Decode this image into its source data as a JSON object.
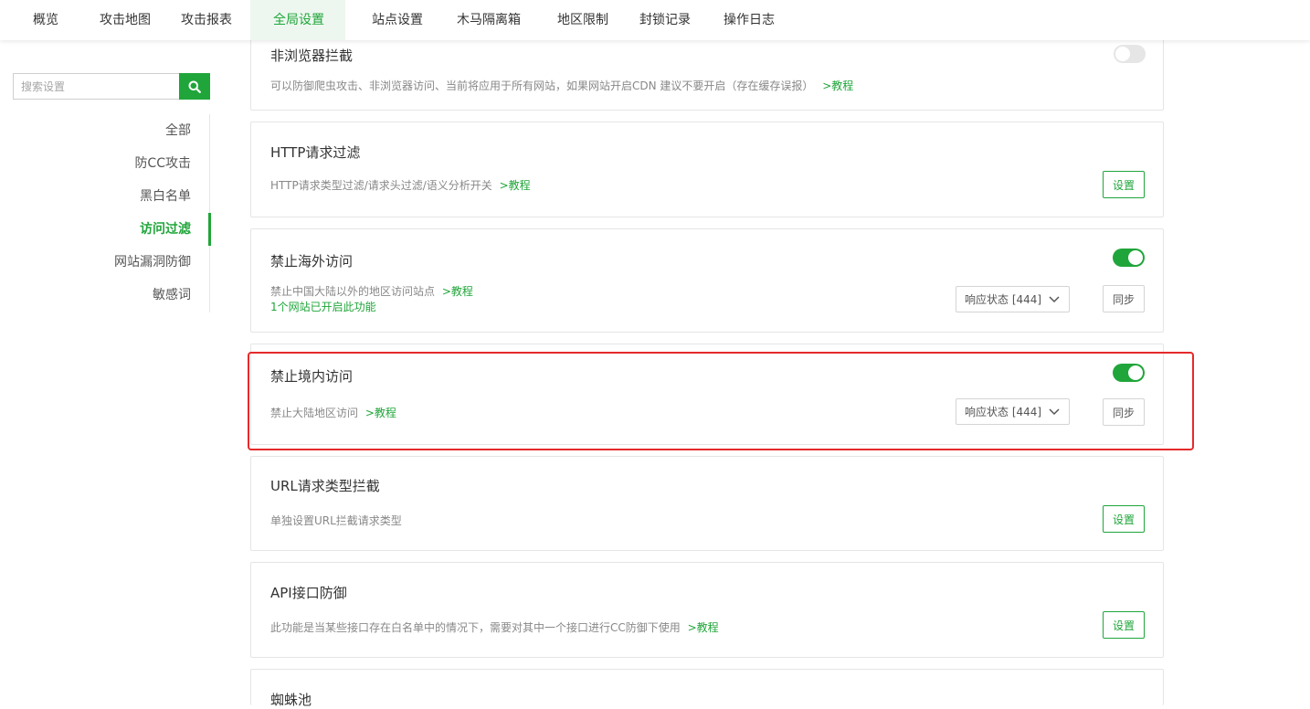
{
  "nav": {
    "tabs": [
      "概览",
      "攻击地图",
      "攻击报表",
      "全局设置",
      "站点设置",
      "木马隔离箱",
      "地区限制",
      "封锁记录",
      "操作日志"
    ],
    "active_index": 3
  },
  "sidebar": {
    "search_placeholder": "搜索设置",
    "items": [
      "全部",
      "防CC攻击",
      "黑白名单",
      "访问过滤",
      "网站漏洞防御",
      "敏感词"
    ],
    "active_index": 3
  },
  "cards": {
    "browser_intercept": {
      "title": "非浏览器拦截",
      "desc": "可以防御爬虫攻击、非浏览器访问、当前将应用于所有网站，如果网站开启CDN 建议不要开启（存在缓存误报）",
      "link": ">教程",
      "enabled": false
    },
    "http_filter": {
      "title": "HTTP请求过滤",
      "desc": "HTTP请求类型过滤/请求头过滤/语义分析开关",
      "link": ">教程",
      "button": "设置"
    },
    "ban_overseas": {
      "title": "禁止海外访问",
      "desc": "禁止中国大陆以外的地区访问站点",
      "link": ">教程",
      "sub": "1个网站已开启此功能",
      "select_value": "响应状态 [444]",
      "button": "同步",
      "enabled": true
    },
    "ban_domestic": {
      "title": "禁止境内访问",
      "desc": "禁止大陆地区访问",
      "link": ">教程",
      "select_value": "响应状态 [444]",
      "button": "同步",
      "enabled": true
    },
    "url_type_intercept": {
      "title": "URL请求类型拦截",
      "desc": "单独设置URL拦截请求类型",
      "button": "设置"
    },
    "api_defense": {
      "title": "API接口防御",
      "desc": "此功能是当某些接口存在白名单中的情况下，需要对其中一个接口进行CC防御下使用",
      "link": ">教程",
      "button": "设置"
    },
    "spider_pool": {
      "title": "蜘蛛池"
    }
  },
  "colors": {
    "accent": "#20a53a",
    "highlight": "#e52a2a"
  }
}
